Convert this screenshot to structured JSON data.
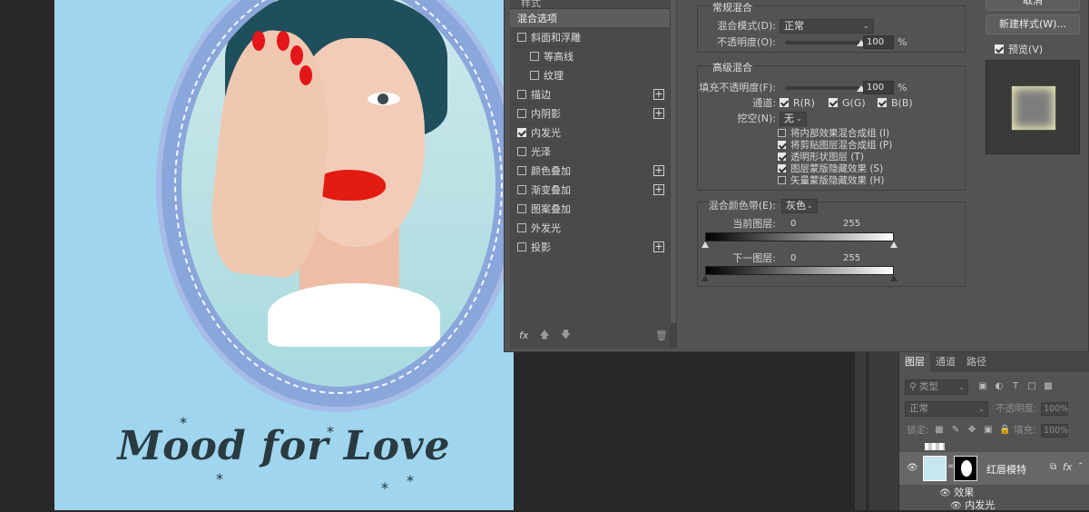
{
  "canvas": {
    "poster_title": "Mood for Love"
  },
  "dialog": {
    "style_header": "样式",
    "styles": [
      {
        "label": "混合选项",
        "checkbox": false,
        "checked": false,
        "active": true,
        "indent": false,
        "plus": false
      },
      {
        "label": "斜面和浮雕",
        "checkbox": true,
        "checked": false,
        "active": false,
        "indent": false,
        "plus": false
      },
      {
        "label": "等高线",
        "checkbox": true,
        "checked": false,
        "active": false,
        "indent": true,
        "plus": false
      },
      {
        "label": "纹理",
        "checkbox": true,
        "checked": false,
        "active": false,
        "indent": true,
        "plus": false
      },
      {
        "label": "描边",
        "checkbox": true,
        "checked": false,
        "active": false,
        "indent": false,
        "plus": true
      },
      {
        "label": "内阴影",
        "checkbox": true,
        "checked": false,
        "active": false,
        "indent": false,
        "plus": true
      },
      {
        "label": "内发光",
        "checkbox": true,
        "checked": true,
        "active": false,
        "indent": false,
        "plus": false
      },
      {
        "label": "光泽",
        "checkbox": true,
        "checked": false,
        "active": false,
        "indent": false,
        "plus": false
      },
      {
        "label": "颜色叠加",
        "checkbox": true,
        "checked": false,
        "active": false,
        "indent": false,
        "plus": true
      },
      {
        "label": "渐变叠加",
        "checkbox": true,
        "checked": false,
        "active": false,
        "indent": false,
        "plus": true
      },
      {
        "label": "图案叠加",
        "checkbox": true,
        "checked": false,
        "active": false,
        "indent": false,
        "plus": false
      },
      {
        "label": "外发光",
        "checkbox": true,
        "checked": false,
        "active": false,
        "indent": false,
        "plus": false
      },
      {
        "label": "投影",
        "checkbox": true,
        "checked": false,
        "active": false,
        "indent": false,
        "plus": true
      }
    ],
    "footer_fx": "fx",
    "general": {
      "title": "常规混合",
      "blend_mode_label": "混合模式(D):",
      "blend_mode_value": "正常",
      "opacity_label": "不透明度(O):",
      "opacity_value": "100",
      "opacity_unit": "%",
      "opacity_level": 1.0
    },
    "advanced": {
      "title": "高级混合",
      "fill_label": "填充不透明度(F):",
      "fill_value": "100",
      "fill_unit": "%",
      "fill_level": 1.0,
      "channels_label": "通道:",
      "channel_r": "R(R)",
      "channel_g": "G(G)",
      "channel_b": "B(B)",
      "knockout_label": "挖空(N):",
      "knockout_value": "无",
      "options": [
        {
          "label": "将内部效果混合成组 (I)",
          "checked": false
        },
        {
          "label": "将剪贴图层混合成组 (P)",
          "checked": true
        },
        {
          "label": "透明形状图层 (T)",
          "checked": true
        },
        {
          "label": "图层蒙版隐藏效果 (S)",
          "checked": true
        },
        {
          "label": "矢量蒙版隐藏效果 (H)",
          "checked": false
        }
      ]
    },
    "blend_if": {
      "label": "混合颜色带(E):",
      "value": "灰色",
      "current_layer_label": "当前图层:",
      "current_low": "0",
      "current_high": "255",
      "underlying_label": "下一图层:",
      "underlying_low": "0",
      "underlying_high": "255"
    },
    "buttons": {
      "cancel": "取消",
      "new_style": "新建样式(W)...",
      "preview": "预览(V)"
    }
  },
  "layers": {
    "tabs": [
      "图层",
      "通道",
      "路径"
    ],
    "filter_kind": "类型",
    "blend_mode": "正常",
    "opacity_label": "不透明度:",
    "opacity_value": "100%",
    "lock_label": "锁定:",
    "fill_label": "填充:",
    "fill_value": "100%",
    "layer_name": "红唇模特",
    "effects_label": "效果",
    "effect_item": "内发光",
    "fx": "fx"
  }
}
